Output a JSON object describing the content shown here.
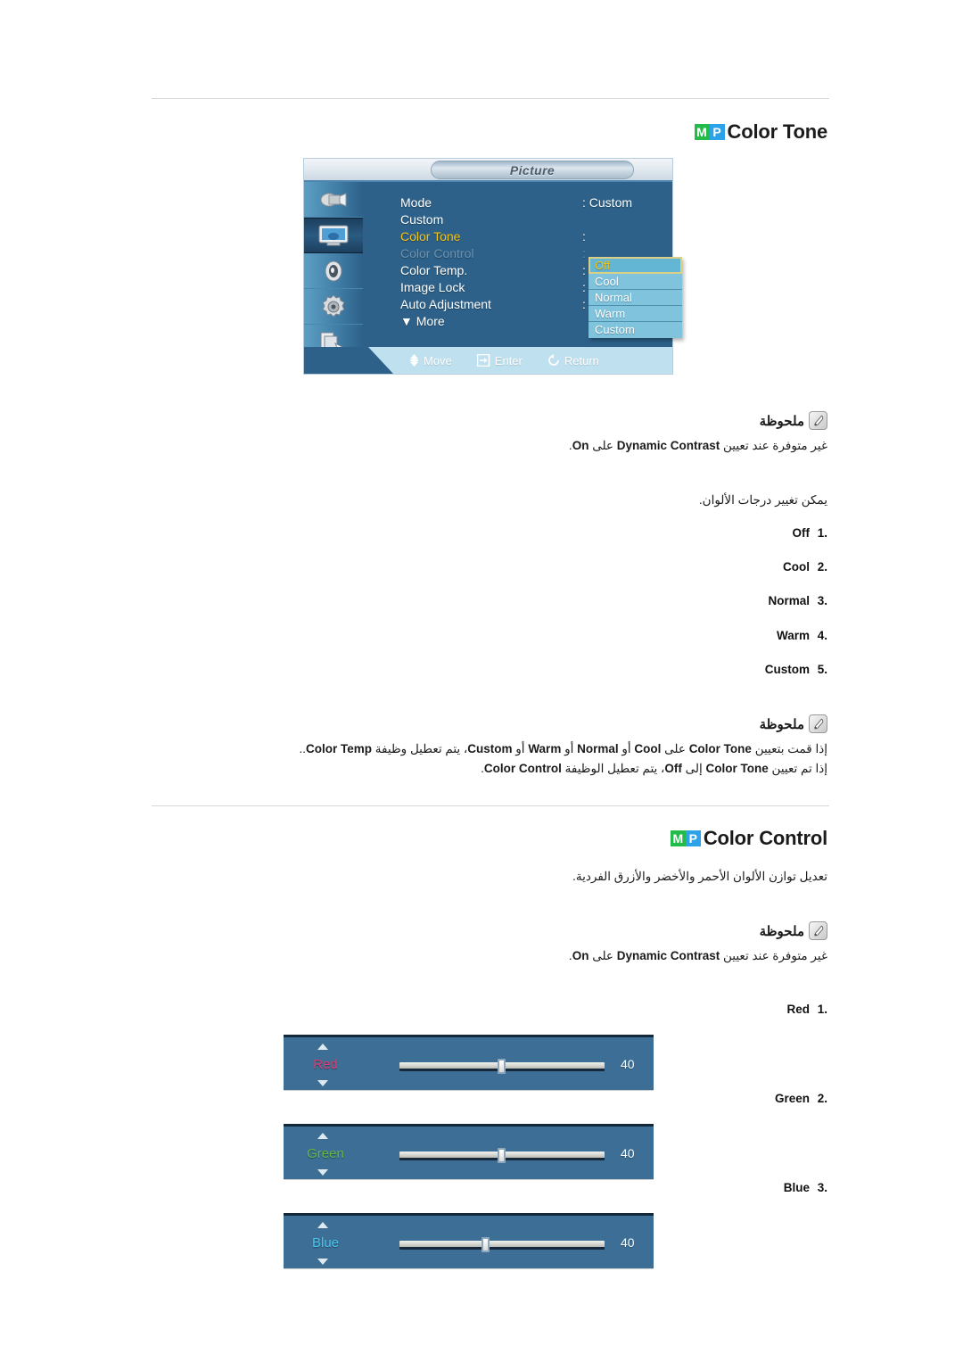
{
  "sections": {
    "color_tone": {
      "title": "Color Tone",
      "badge": {
        "m": "M",
        "p": "P"
      },
      "osd": {
        "window_title": "Picture",
        "menu_items": [
          {
            "label": "Mode",
            "value": ": Custom",
            "state": "normal"
          },
          {
            "label": "Custom",
            "value": "",
            "state": "normal"
          },
          {
            "label": "Color Tone",
            "value": ":",
            "state": "selected"
          },
          {
            "label": "Color Control",
            "value": ":",
            "state": "disabled"
          },
          {
            "label": "Color Temp.",
            "value": ":",
            "state": "normal"
          },
          {
            "label": "Image Lock",
            "value": ":",
            "state": "normal"
          },
          {
            "label": "Auto Adjustment",
            "value": ":",
            "state": "normal"
          },
          {
            "label": "▼ More",
            "value": "",
            "state": "normal"
          }
        ],
        "dropdown": [
          {
            "label": "Off",
            "highlighted": true
          },
          {
            "label": "Cool",
            "highlighted": false
          },
          {
            "label": "Normal",
            "highlighted": false
          },
          {
            "label": "Warm",
            "highlighted": false
          },
          {
            "label": "Custom",
            "highlighted": false
          }
        ],
        "footer": [
          {
            "icon": "move-icon",
            "label": "Move"
          },
          {
            "icon": "enter-icon",
            "label": "Enter"
          },
          {
            "icon": "return-icon",
            "label": "Return"
          }
        ],
        "sidebar_icons": [
          "input-icon",
          "picture-icon",
          "sound-icon",
          "setup-icon",
          "multi-control-icon"
        ]
      },
      "note1": {
        "heading": "ملحوظة",
        "body_pre": "غير متوفرة عند تعيين ",
        "body_bold1": "Dynamic Contrast",
        "body_mid": " على ",
        "body_bold2": "On",
        "body_post": "."
      },
      "intro": "يمكن تغيير درجات الألوان.",
      "options": [
        {
          "index": ".1",
          "label": "Off"
        },
        {
          "index": ".2",
          "label": "Cool"
        },
        {
          "index": ".3",
          "label": "Normal"
        },
        {
          "index": ".4",
          "label": "Warm"
        },
        {
          "index": ".5",
          "label": "Custom"
        }
      ],
      "note2": {
        "heading": "ملحوظة",
        "line1_a": "إذا قمت بتعيين ",
        "line1_b1": "Color Tone",
        "line1_c": " على ",
        "line1_b2": "Cool",
        "line1_d": " أو ",
        "line1_b3": "Normal",
        "line1_e": " أو ",
        "line1_b4": "Warm",
        "line1_f": " أو ",
        "line1_b5": "Custom",
        "line1_g": "، يتم تعطيل وظيفة ",
        "line1_b6": "Color Temp",
        "line1_h": "..",
        "line2_a": "إذا تم تعيين ",
        "line2_b1": "Color Tone",
        "line2_c": " إلى ",
        "line2_b2": "Off",
        "line2_d": "، يتم تعطيل الوظيفة ",
        "line2_b3": "Color Control",
        "line2_e": "."
      }
    },
    "color_control": {
      "title": "Color Control",
      "badge": {
        "m": "M",
        "p": "P"
      },
      "intro": "تعديل توازن الألوان الأحمر والأخضر والأزرق الفردية.",
      "note": {
        "heading": "ملحوظة",
        "body_pre": "غير متوفرة عند تعيين ",
        "body_bold1": "Dynamic Contrast",
        "body_mid": " على ",
        "body_bold2": "On",
        "body_post": "."
      },
      "channels": [
        {
          "index": ".1",
          "name": "Red",
          "label": "Red",
          "value": "40",
          "color": "#e8386f",
          "knob_pct": 48
        },
        {
          "index": ".2",
          "name": "Green",
          "label": "Green",
          "value": "40",
          "color": "#63b842",
          "knob_pct": 48
        },
        {
          "index": ".3",
          "name": "Blue",
          "label": "Blue",
          "value": "40",
          "color": "#49c6ef",
          "knob_pct": 40
        }
      ]
    }
  }
}
